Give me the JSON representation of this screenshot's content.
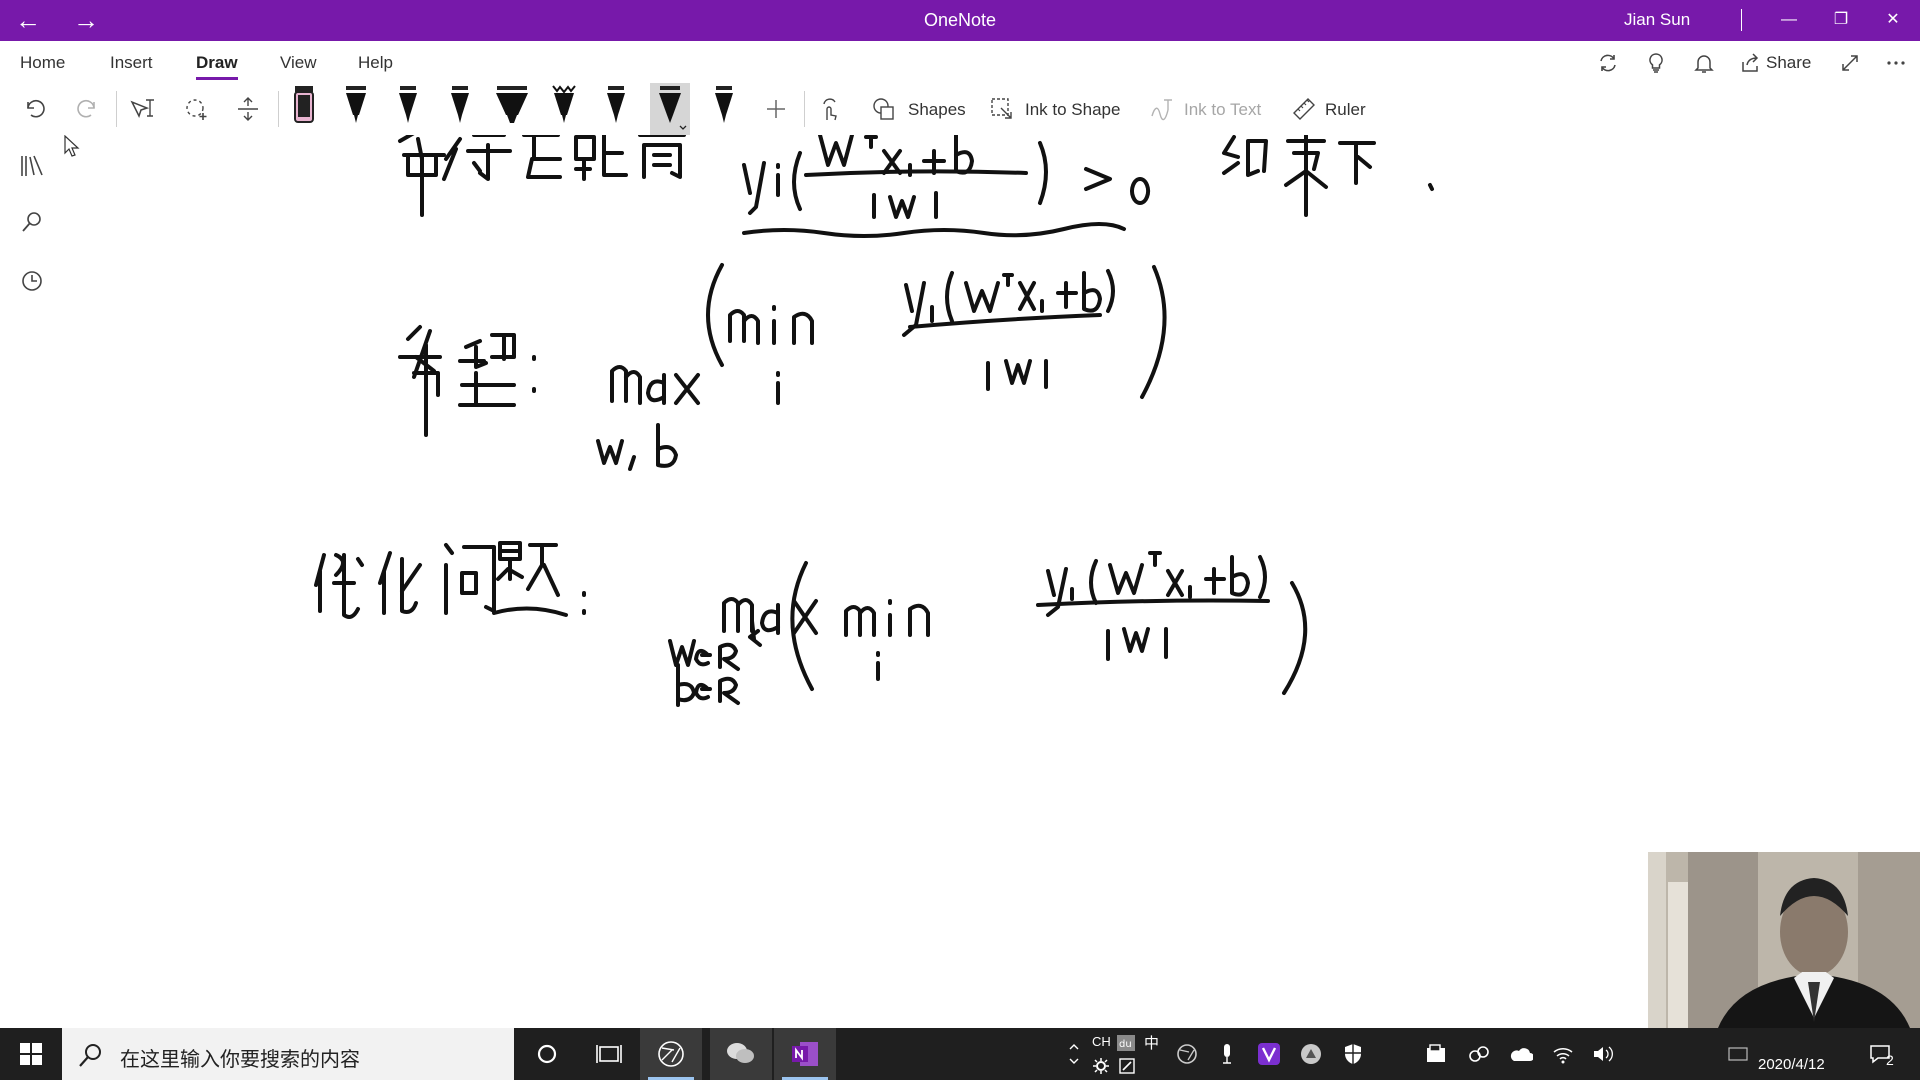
{
  "app": {
    "title": "OneNote",
    "user": "Jian Sun",
    "brand_color": "#7719aa"
  },
  "menu": {
    "tabs": [
      {
        "label": "Home",
        "active": false
      },
      {
        "label": "Insert",
        "active": false
      },
      {
        "label": "Draw",
        "active": true
      },
      {
        "label": "View",
        "active": false
      },
      {
        "label": "Help",
        "active": false
      }
    ],
    "share_label": "Share",
    "right_icons": [
      "sync-icon",
      "lightbulb-icon",
      "bell-icon",
      "share-icon",
      "expand-icon",
      "more-icon"
    ]
  },
  "toolbar": {
    "tools": [
      "undo-icon",
      "redo-icon",
      "lasso-select-icon",
      "lasso-shape-icon",
      "add-space-icon"
    ],
    "pens": [
      {
        "name": "highlighter-pink",
        "color": "#e8b4d0"
      },
      {
        "name": "pen-black-1",
        "color": "#000000"
      },
      {
        "name": "pen-black-2",
        "color": "#000000"
      },
      {
        "name": "pen-black-3",
        "color": "#000000"
      },
      {
        "name": "highlighter-black",
        "color": "#000000"
      },
      {
        "name": "pen-galaxy",
        "color": "#000000"
      },
      {
        "name": "pen-black-4",
        "color": "#000000"
      },
      {
        "name": "pen-black-selected",
        "color": "#000000",
        "selected": true
      },
      {
        "name": "pen-black-5",
        "color": "#000000"
      }
    ],
    "shapes_label": "Shapes",
    "ink_to_shape_label": "Ink to Shape",
    "ink_to_text_label": "Ink to Text",
    "ruler_label": "Ruler"
  },
  "rail": [
    "notebooks-icon",
    "search-icon",
    "recent-icon"
  ],
  "taskbar": {
    "search_placeholder": "在这里输入你要搜索的内容",
    "apps": [
      "cortana-icon",
      "task-view-icon",
      "browser-icon",
      "wechat-icon",
      "onenote-icon"
    ],
    "lang": "CH",
    "ime": "中",
    "date": "2020/4/12",
    "notification_count": "2"
  }
}
